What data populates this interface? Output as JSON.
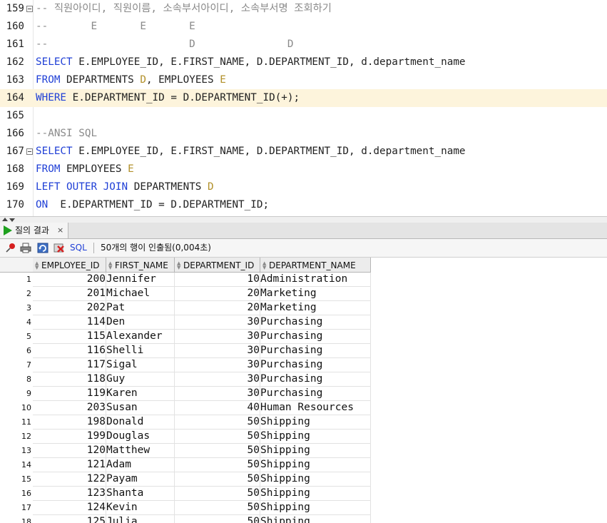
{
  "editor": {
    "lines": [
      {
        "num": "159",
        "fold": true,
        "highlight": false,
        "tokens": [
          {
            "t": "-- 직원아이디, 직원이름, 소속부서아이디, 소속부서명 조회하기",
            "c": "cm"
          }
        ]
      },
      {
        "num": "160",
        "fold": false,
        "highlight": false,
        "tokens": [
          {
            "t": "--       E       E       E",
            "c": "cm"
          }
        ]
      },
      {
        "num": "161",
        "fold": false,
        "highlight": false,
        "tokens": [
          {
            "t": "--                       D               D",
            "c": "cm"
          }
        ]
      },
      {
        "num": "162",
        "fold": false,
        "highlight": false,
        "tokens": [
          {
            "t": "SELECT",
            "c": "kw"
          },
          {
            "t": " E.EMPLOYEE_ID, E.FIRST_NAME, D.DEPARTMENT_ID, d.department_name",
            "c": "pl"
          }
        ]
      },
      {
        "num": "163",
        "fold": false,
        "highlight": false,
        "tokens": [
          {
            "t": "FROM",
            "c": "kw"
          },
          {
            "t": " DEPARTMENTS ",
            "c": "pl"
          },
          {
            "t": "D",
            "c": "al"
          },
          {
            "t": ", EMPLOYEES ",
            "c": "pl"
          },
          {
            "t": "E",
            "c": "al"
          }
        ]
      },
      {
        "num": "164",
        "fold": false,
        "highlight": true,
        "tokens": [
          {
            "t": "WHERE",
            "c": "kw"
          },
          {
            "t": " E.DEPARTMENT_ID = D.DEPARTMENT_ID(+);",
            "c": "pl"
          }
        ]
      },
      {
        "num": "165",
        "fold": false,
        "highlight": false,
        "tokens": []
      },
      {
        "num": "166",
        "fold": false,
        "highlight": false,
        "tokens": [
          {
            "t": "--ANSI SQL",
            "c": "cm"
          }
        ]
      },
      {
        "num": "167",
        "fold": true,
        "highlight": false,
        "tokens": [
          {
            "t": "SELECT",
            "c": "kw"
          },
          {
            "t": " E.EMPLOYEE_ID, E.FIRST_NAME, D.DEPARTMENT_ID, d.department_name",
            "c": "pl"
          }
        ]
      },
      {
        "num": "168",
        "fold": false,
        "highlight": false,
        "tokens": [
          {
            "t": "FROM",
            "c": "kw"
          },
          {
            "t": " EMPLOYEES ",
            "c": "pl"
          },
          {
            "t": "E",
            "c": "al"
          }
        ]
      },
      {
        "num": "169",
        "fold": false,
        "highlight": false,
        "tokens": [
          {
            "t": "LEFT OUTER JOIN",
            "c": "kw"
          },
          {
            "t": " DEPARTMENTS ",
            "c": "pl"
          },
          {
            "t": "D",
            "c": "al"
          }
        ]
      },
      {
        "num": "170",
        "fold": false,
        "highlight": false,
        "tokens": [
          {
            "t": "ON",
            "c": "kw"
          },
          {
            "t": "  E.DEPARTMENT_ID = D.DEPARTMENT_ID;",
            "c": "pl"
          }
        ]
      }
    ]
  },
  "result_tab": {
    "label": "질의 결과",
    "close": "×"
  },
  "toolbar": {
    "sql_label": "SQL",
    "status": "50개의 행이 인출됨(0,004초)"
  },
  "grid": {
    "columns": [
      "EMPLOYEE_ID",
      "FIRST_NAME",
      "DEPARTMENT_ID",
      "DEPARTMENT_NAME"
    ],
    "rows": [
      [
        "1",
        "200",
        "Jennifer",
        "10",
        "Administration"
      ],
      [
        "2",
        "201",
        "Michael",
        "20",
        "Marketing"
      ],
      [
        "3",
        "202",
        "Pat",
        "20",
        "Marketing"
      ],
      [
        "4",
        "114",
        "Den",
        "30",
        "Purchasing"
      ],
      [
        "5",
        "115",
        "Alexander",
        "30",
        "Purchasing"
      ],
      [
        "6",
        "116",
        "Shelli",
        "30",
        "Purchasing"
      ],
      [
        "7",
        "117",
        "Sigal",
        "30",
        "Purchasing"
      ],
      [
        "8",
        "118",
        "Guy",
        "30",
        "Purchasing"
      ],
      [
        "9",
        "119",
        "Karen",
        "30",
        "Purchasing"
      ],
      [
        "10",
        "203",
        "Susan",
        "40",
        "Human Resources"
      ],
      [
        "11",
        "198",
        "Donald",
        "50",
        "Shipping"
      ],
      [
        "12",
        "199",
        "Douglas",
        "50",
        "Shipping"
      ],
      [
        "13",
        "120",
        "Matthew",
        "50",
        "Shipping"
      ],
      [
        "14",
        "121",
        "Adam",
        "50",
        "Shipping"
      ],
      [
        "15",
        "122",
        "Payam",
        "50",
        "Shipping"
      ],
      [
        "16",
        "123",
        "Shanta",
        "50",
        "Shipping"
      ],
      [
        "17",
        "124",
        "Kevin",
        "50",
        "Shipping"
      ],
      [
        "18",
        "125",
        "Julia",
        "50",
        "Shipping"
      ]
    ]
  }
}
